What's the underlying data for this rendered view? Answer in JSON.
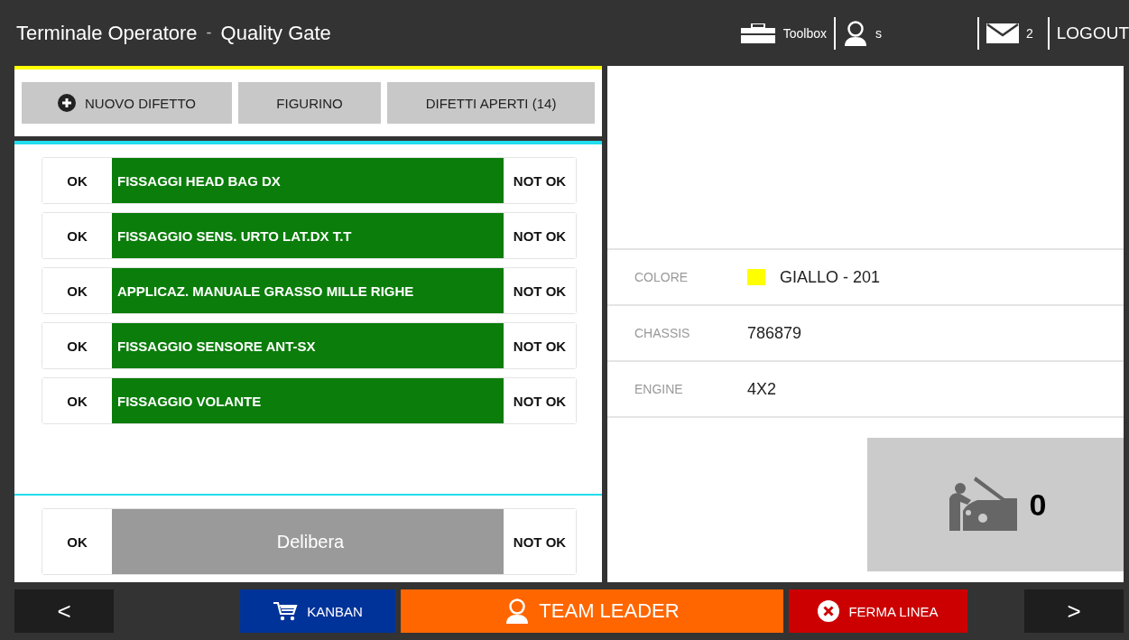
{
  "header": {
    "title": "Terminale Operatore",
    "separator": "-",
    "subtitle": "Quality Gate",
    "toolbox": "Toolbox",
    "user": "s",
    "messages": "2",
    "logout": "LOGOUT"
  },
  "actions": [
    {
      "label": "NUOVO DIFETTO",
      "kind": "add"
    },
    {
      "label": "FIGURINO",
      "kind": "plain"
    },
    {
      "label": "DIFETTI APERTI (14)",
      "kind": "plain"
    }
  ],
  "checks": [
    {
      "ok": "OK",
      "label": "FISSAGGI HEAD BAG DX",
      "not_ok": "NOT OK"
    },
    {
      "ok": "OK",
      "label": "FISSAGGIO SENS. URTO LAT.DX T.T",
      "not_ok": "NOT OK"
    },
    {
      "ok": "OK",
      "label": "APPLICAZ. MANUALE GRASSO MILLE RIGHE",
      "not_ok": "NOT OK"
    },
    {
      "ok": "OK",
      "label": "FISSAGGIO SENSORE ANT-SX",
      "not_ok": "NOT OK"
    },
    {
      "ok": "OK",
      "label": "FISSAGGIO VOLANTE",
      "not_ok": "NOT OK"
    }
  ],
  "release": {
    "ok": "OK",
    "label": "Delibera",
    "not_ok": "NOT OK",
    "disabled": true
  },
  "details": [
    {
      "label": "COLORE",
      "value": "GIALLO - 201",
      "color": "#ffff00"
    },
    {
      "label": "CHASSIS",
      "value": "786879"
    },
    {
      "label": "ENGINE",
      "value": "4X2"
    }
  ],
  "repair_count": "0",
  "footer": [
    {
      "label": "<",
      "kind": "nav"
    },
    {
      "label": "KANBAN",
      "kind": "kanban"
    },
    {
      "label": "TEAM LEADER",
      "kind": "leader"
    },
    {
      "label": "FERMA LINEA",
      "kind": "stop"
    },
    {
      "label": ">",
      "kind": "nav"
    }
  ]
}
